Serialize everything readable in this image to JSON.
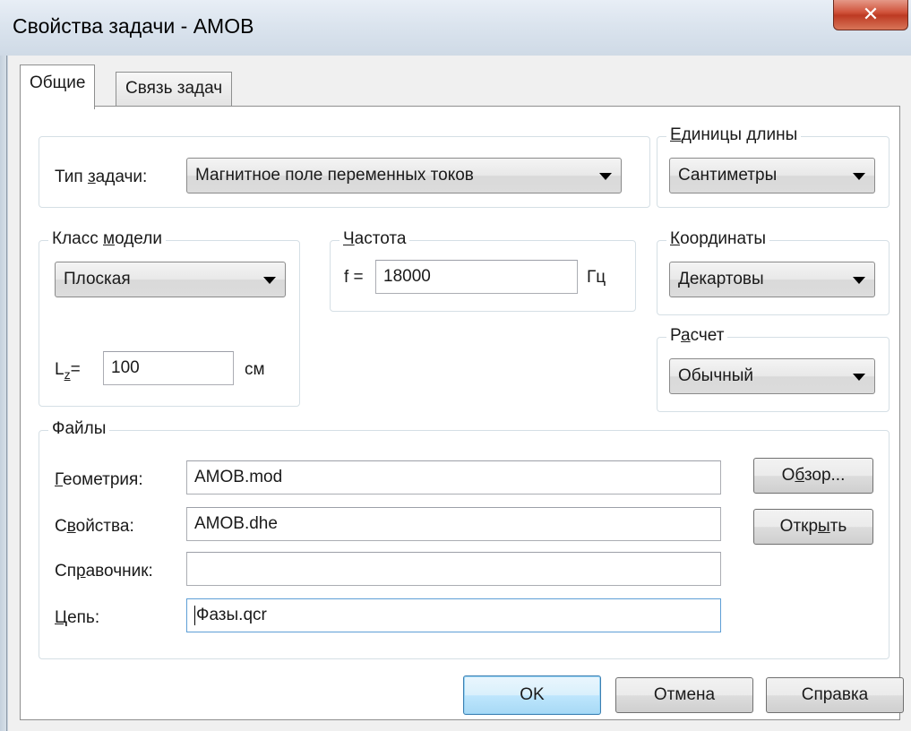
{
  "window": {
    "title": "Свойства задачи - AMOB",
    "close_glyph": "✕"
  },
  "tabs": [
    {
      "label": "Общие",
      "active": true
    },
    {
      "label": "Связь задач",
      "active": false
    }
  ],
  "task_type": {
    "label_prefix": "Тип ",
    "label_access": "з",
    "label_suffix": "адачи:",
    "value": "Магнитное поле переменных токов"
  },
  "length_units": {
    "legend_access": "Е",
    "legend_rest": "диницы длины",
    "value": "Сантиметры"
  },
  "model_class": {
    "legend_prefix": "Класс ",
    "legend_access": "м",
    "legend_rest": "одели",
    "value": "Плоская",
    "lz_base": "L",
    "lz_sub": "z",
    "lz_eq": "=",
    "lz_value": "100",
    "lz_unit": "см"
  },
  "frequency": {
    "legend_access": "Ч",
    "legend_rest": "астота",
    "f_label": "f =",
    "value": "18000",
    "unit": "Гц"
  },
  "coordinates": {
    "legend_access": "К",
    "legend_rest": "оординаты",
    "value": "Декартовы"
  },
  "calculation": {
    "legend_prefix": "Р",
    "legend_access": "а",
    "legend_rest": "счет",
    "value": "Обычный"
  },
  "files": {
    "legend": "Файлы",
    "geometry": {
      "access": "Г",
      "rest": "еометрия:",
      "value": "AMOB.mod"
    },
    "properties": {
      "prefix": "С",
      "access": "в",
      "rest": "ойства:",
      "value": "AMOB.dhe"
    },
    "reference": {
      "prefix": "Сп",
      "access": "р",
      "rest": "авочник:",
      "value": ""
    },
    "circuit": {
      "access": "Ц",
      "rest": "епь:",
      "value": "Фазы.qcr"
    },
    "browse": {
      "prefix": "О",
      "access": "б",
      "rest": "зор..."
    },
    "open": {
      "prefix": "Откр",
      "access": "ы",
      "rest": "ть"
    }
  },
  "footer": {
    "ok": "OK",
    "cancel": "Отмена",
    "help": "Справка"
  },
  "colors": {
    "close_button": "#c9452c",
    "default_button_border": "#3c7fb1",
    "title_bar": "#dbe4ee"
  }
}
